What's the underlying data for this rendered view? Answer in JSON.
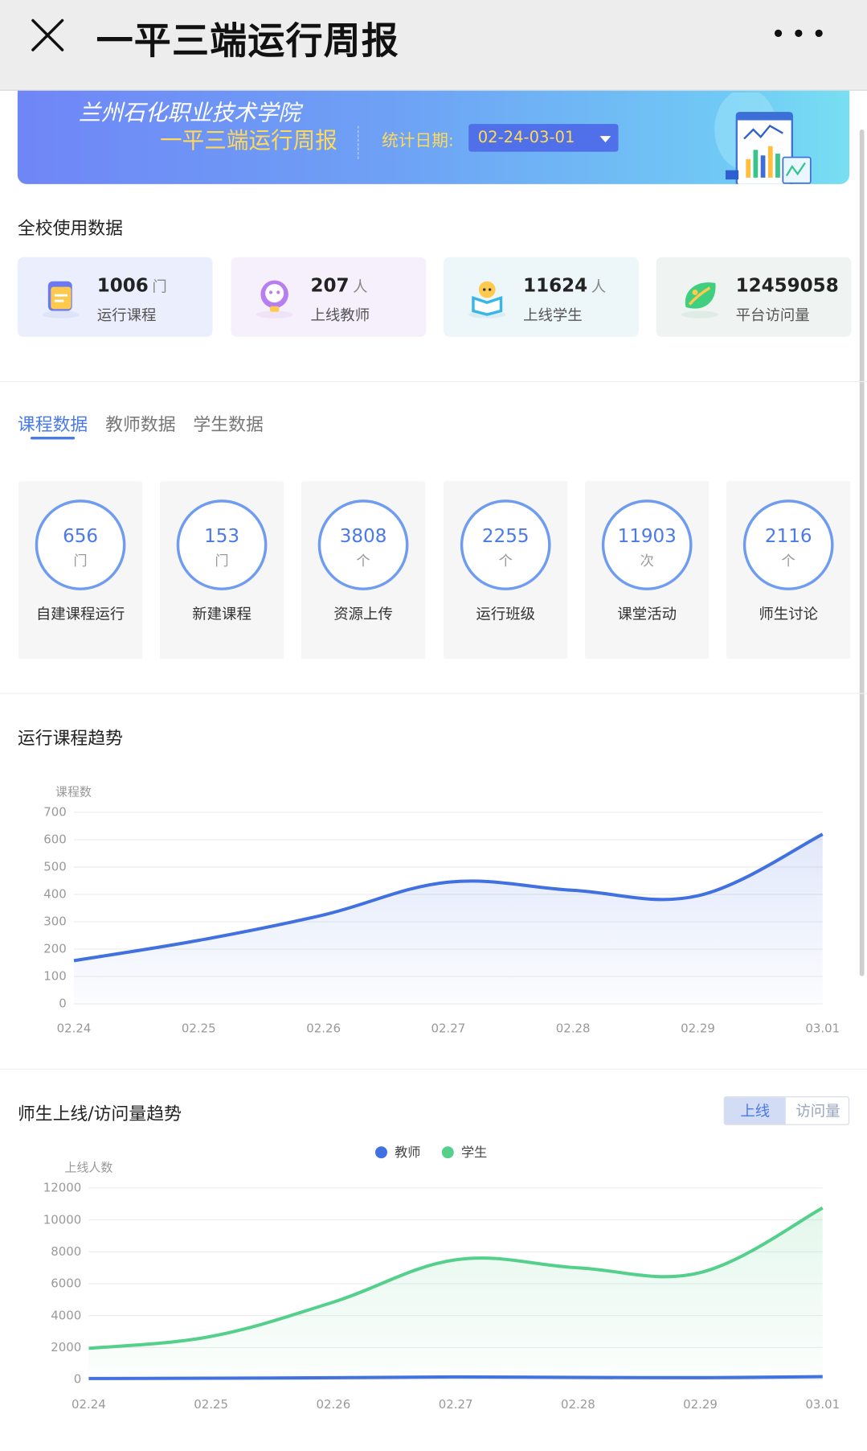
{
  "topbar": {
    "title": "一平三端运行周报"
  },
  "banner": {
    "school": "兰州石化职业技术学院",
    "report_title": "一平三端运行周报",
    "date_label": "统计日期:",
    "date_value": "02-24-03-01"
  },
  "overview": {
    "title": "全校使用数据",
    "stats": [
      {
        "value": "1006",
        "unit": "门",
        "label": "运行课程",
        "icon": "course-book-icon",
        "bg": "#ebeefc"
      },
      {
        "value": "207",
        "unit": "人",
        "label": "上线教师",
        "icon": "teacher-icon",
        "bg": "#f5f0fb"
      },
      {
        "value": "11624",
        "unit": "人",
        "label": "上线学生",
        "icon": "student-icon",
        "bg": "#edf6f9"
      },
      {
        "value": "12459058",
        "unit": "",
        "label": "平台访问量",
        "icon": "visits-leaf-icon",
        "bg": "#eff4f2"
      }
    ]
  },
  "tabs": [
    "课程数据",
    "教师数据",
    "学生数据"
  ],
  "course_cards": [
    {
      "value": "656",
      "unit": "门",
      "label": "自建课程运行"
    },
    {
      "value": "153",
      "unit": "门",
      "label": "新建课程"
    },
    {
      "value": "3808",
      "unit": "个",
      "label": "资源上传"
    },
    {
      "value": "2255",
      "unit": "个",
      "label": "运行班级"
    },
    {
      "value": "11903",
      "unit": "次",
      "label": "课堂活动"
    },
    {
      "value": "2116",
      "unit": "个",
      "label": "师生讨论"
    }
  ],
  "course_trend": {
    "title": "运行课程趋势"
  },
  "online_trend": {
    "title": "师生上线/访问量趋势",
    "toggle": [
      "上线",
      "访问量"
    ]
  },
  "colors": {
    "accent": "#4a7ae8",
    "teacher": "#4170e0",
    "student": "#55d08c"
  },
  "chart_data": [
    {
      "type": "area",
      "ylabel": "课程数",
      "categories": [
        "02.24",
        "02.25",
        "02.26",
        "02.27",
        "02.28",
        "02.29",
        "03.01"
      ],
      "ylim": [
        0,
        700
      ],
      "yticks": [
        0,
        100,
        200,
        300,
        400,
        500,
        600,
        700
      ],
      "series": [
        {
          "values": [
            158,
            232,
            325,
            445,
            415,
            395,
            620
          ]
        }
      ],
      "grid": true
    },
    {
      "type": "area",
      "ylabel": "上线人数",
      "categories": [
        "02.24",
        "02.25",
        "02.26",
        "02.27",
        "02.28",
        "02.29",
        "03.01"
      ],
      "ylim": [
        0,
        12000
      ],
      "yticks": [
        0,
        2000,
        4000,
        6000,
        8000,
        10000,
        12000
      ],
      "legend": "top-center",
      "series": [
        {
          "name": "教师",
          "values": [
            60,
            80,
            110,
            160,
            130,
            115,
            180
          ]
        },
        {
          "name": "学生",
          "values": [
            1950,
            2700,
            4850,
            7500,
            7000,
            6700,
            10750
          ]
        }
      ],
      "grid": true
    }
  ]
}
